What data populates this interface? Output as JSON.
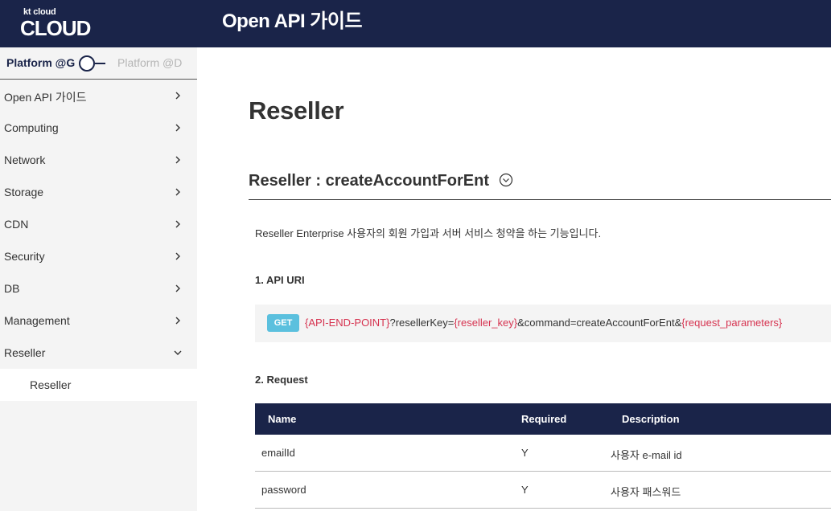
{
  "header": {
    "logo_small": "kt cloud",
    "logo_big": "CLOUD",
    "title": "Open API 가이드"
  },
  "sidebar": {
    "platform_active": "Platform @G",
    "platform_inactive": "Platform @D",
    "items": [
      {
        "label": "Open API 가이드",
        "icon": "chevron-right-icon"
      },
      {
        "label": "Computing",
        "icon": "chevron-right-icon"
      },
      {
        "label": "Network",
        "icon": "chevron-right-icon"
      },
      {
        "label": "Storage",
        "icon": "chevron-right-icon"
      },
      {
        "label": "CDN",
        "icon": "chevron-right-icon"
      },
      {
        "label": "Security",
        "icon": "chevron-right-icon"
      },
      {
        "label": "DB",
        "icon": "chevron-right-icon"
      },
      {
        "label": "Management",
        "icon": "chevron-right-icon"
      },
      {
        "label": "Reseller",
        "icon": "chevron-down-icon"
      }
    ],
    "subitem": "Reseller"
  },
  "main": {
    "page_title": "Reseller",
    "section_title": "Reseller : createAccountForEnt",
    "description": "Reseller Enterprise 사용자의 회원 가입과 서버 서비스 청약을 하는 기능입니다.",
    "uri_heading": "1. API URI",
    "method": "GET",
    "uri": {
      "p1": "{API-END-POINT}",
      "p2": "?resellerKey=",
      "p3": "{reseller_key}",
      "p4": "&command=createAccountForEnt&",
      "p5": "{request_parameters}"
    },
    "request_heading": "2. Request",
    "table": {
      "headers": {
        "name": "Name",
        "required": "Required",
        "description": "Description"
      },
      "rows": [
        {
          "name": "emailId",
          "required": "Y",
          "description": "사용자 e-mail id"
        },
        {
          "name": "password",
          "required": "Y",
          "description": "사용자 패스워드"
        }
      ]
    }
  },
  "colors": {
    "navy": "#1a2449",
    "badge": "#5bc0de",
    "highlight": "#d63350"
  }
}
